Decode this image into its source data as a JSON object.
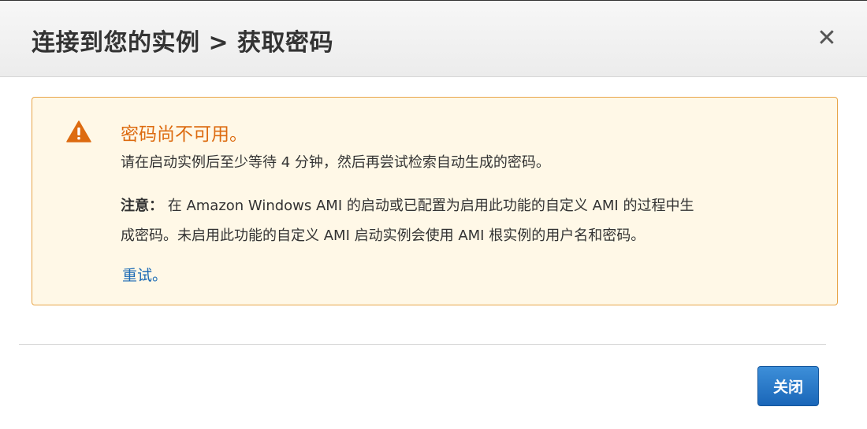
{
  "dialog": {
    "title": "连接到您的实例 > 获取密码",
    "close_icon": "close-icon"
  },
  "alert": {
    "icon": "warning-icon",
    "title": "密码尚不可用。",
    "description": "请在启动实例后至少等待 4 分钟，然后再尝试检索自动生成的密码。",
    "note_label": "注意：",
    "note_line1": "在 Amazon Windows AMI 的启动或已配置为启用此功能的自定义 AMI 的过程中生",
    "note_line2": "成密码。未启用此功能的自定义 AMI 启动实例会使用 AMI 根实例的用户名和密码。",
    "retry_link": "重试。"
  },
  "footer": {
    "close_button": "关闭"
  },
  "colors": {
    "warning": "#dd6b10",
    "alert_bg": "#fff8e7",
    "alert_border": "#e8a548",
    "link": "#1b6ab5",
    "primary_button": "#1f71c2"
  }
}
